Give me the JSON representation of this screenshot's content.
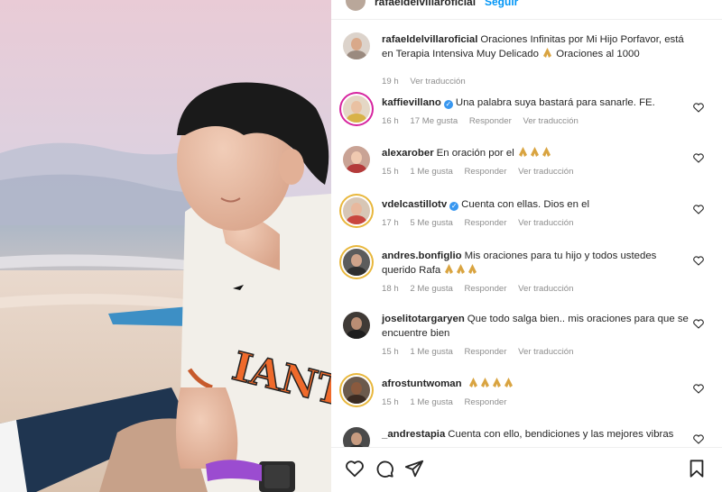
{
  "post_header": {
    "username": "rafaeldelvillaroficial",
    "follow_label": "Seguir"
  },
  "caption": {
    "username": "rafaeldelvillaroficial",
    "text_before": "Oraciones Infinitas por Mi Hijo Porfavor, está en Terapia Intensiva Muy Delicado",
    "text_after": "Oraciones al 1000",
    "time": "19 h",
    "translate": "Ver traducción"
  },
  "comments": [
    {
      "username": "kaffievillano",
      "verified": true,
      "text": "Una palabra suya bastará para sanarle. FE.",
      "emoji_count": 0,
      "time": "16 h",
      "likes": "17 Me gusta",
      "reply": "Responder",
      "translate": "Ver traducción"
    },
    {
      "username": "alexarober",
      "verified": false,
      "text": "En oración por el",
      "emoji_count": 3,
      "time": "15 h",
      "likes": "1 Me gusta",
      "reply": "Responder",
      "translate": "Ver traducción"
    },
    {
      "username": "vdelcastillotv",
      "verified": true,
      "text": "Cuenta con ellas. Dios en el",
      "emoji_count": 0,
      "time": "17 h",
      "likes": "5 Me gusta",
      "reply": "Responder",
      "translate": "Ver traducción"
    },
    {
      "username": "andres.bonfiglio",
      "verified": false,
      "text": "Mis oraciones para tu hijo y todos ustedes querido Rafa",
      "emoji_count": 3,
      "time": "18 h",
      "likes": "2 Me gusta",
      "reply": "Responder",
      "translate": "Ver traducción"
    },
    {
      "username": "joselitotargaryen",
      "verified": false,
      "text": "Que todo salga bien.. mis oraciones para que se encuentre bien",
      "emoji_count": 0,
      "time": "15 h",
      "likes": "1 Me gusta",
      "reply": "Responder",
      "translate": "Ver traducción"
    },
    {
      "username": "afrostuntwoman",
      "verified": false,
      "text": "",
      "emoji_count": 4,
      "time": "15 h",
      "likes": "1 Me gusta",
      "reply": "Responder",
      "translate": ""
    },
    {
      "username": "_andrestapia",
      "verified": false,
      "text": "Cuenta con ello, bendiciones y las mejores vibras",
      "emoji_count": 0,
      "time": "",
      "likes": "",
      "reply": "",
      "translate": ""
    }
  ],
  "actions": [
    "heart-icon",
    "comment-icon",
    "share-icon",
    "bookmark-icon"
  ],
  "colors": {
    "accent": "#0095f6",
    "verified": "#3897f0",
    "muted": "#8e8e8e",
    "text": "#262626"
  }
}
